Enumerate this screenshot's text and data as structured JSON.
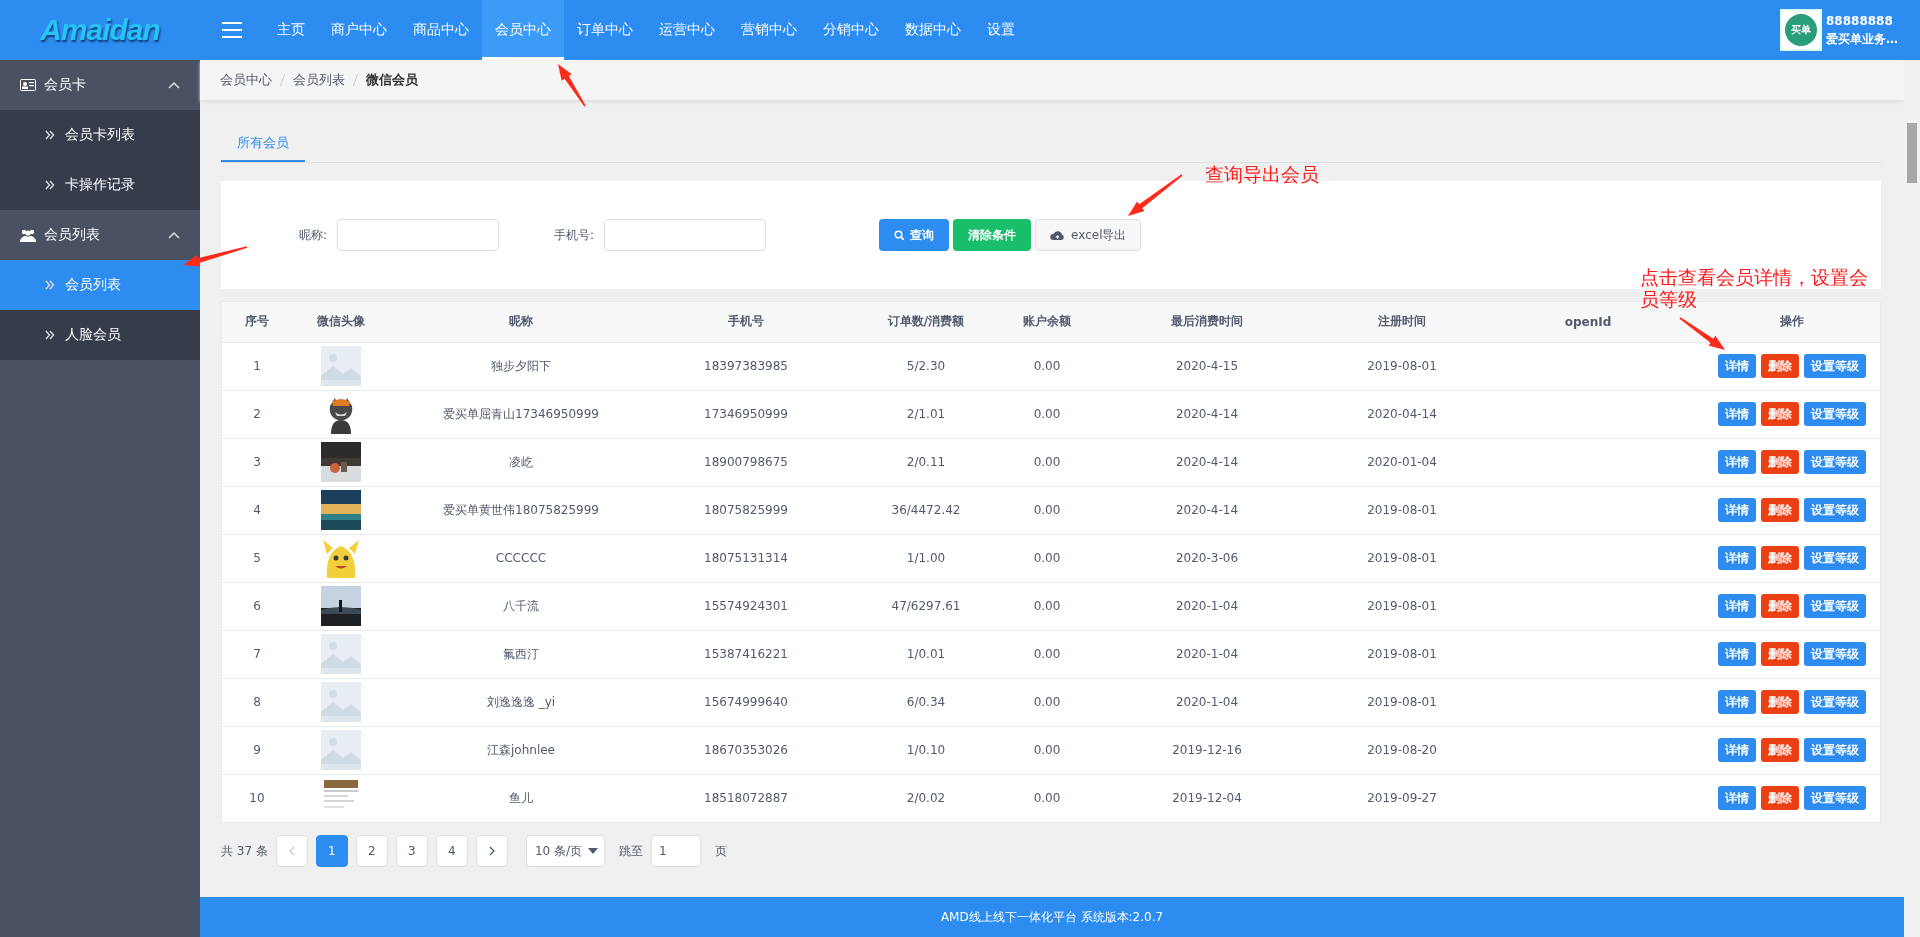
{
  "logo": "Amaidan",
  "nav": [
    {
      "label": "主页",
      "selected": false
    },
    {
      "label": "商户中心",
      "selected": false
    },
    {
      "label": "商品中心",
      "selected": false
    },
    {
      "label": "会员中心",
      "selected": true
    },
    {
      "label": "订单中心",
      "selected": false
    },
    {
      "label": "运营中心",
      "selected": false
    },
    {
      "label": "营销中心",
      "selected": false
    },
    {
      "label": "分销中心",
      "selected": false
    },
    {
      "label": "数据中心",
      "selected": false
    },
    {
      "label": "设置",
      "selected": false
    }
  ],
  "user": {
    "badge": "买单",
    "id": "88888888",
    "name": "爱买单业务…"
  },
  "sidebar": [
    {
      "label": "会员卡",
      "kind": "card",
      "expanded": true,
      "children": [
        {
          "label": "会员卡列表",
          "selected": false
        },
        {
          "label": "卡操作记录",
          "selected": false
        }
      ]
    },
    {
      "label": "会员列表",
      "kind": "users",
      "expanded": true,
      "children": [
        {
          "label": "会员列表",
          "selected": true
        },
        {
          "label": "人脸会员",
          "selected": false
        }
      ]
    }
  ],
  "breadcrumb": [
    "会员中心",
    "会员列表",
    "微信会员"
  ],
  "tabs": [
    {
      "label": "所有会员",
      "selected": true
    }
  ],
  "filters": [
    {
      "label": "昵称:"
    },
    {
      "label": "手机号:"
    }
  ],
  "buttons": [
    {
      "kind": "search",
      "label": "查询"
    },
    {
      "kind": "clear",
      "label": "清除条件"
    },
    {
      "kind": "export",
      "label": "excel导出"
    }
  ],
  "table": {
    "columns": [
      "序号",
      "微信头像",
      "昵称",
      "手机号",
      "订单数/消费额",
      "账户余额",
      "最后消费时间",
      "注册时间",
      "openId",
      "操作"
    ],
    "rows": [
      {
        "no": "1",
        "avatar": {
          "kind": "picture"
        },
        "nickname": "独步夕阳下",
        "phone": "18397383985",
        "orders": "5/2.30",
        "balance": "0.00",
        "last": "2020-4-15",
        "registered": "2019-08-01",
        "actions": [
          {
            "kind": "primary",
            "label": "详情"
          },
          {
            "kind": "danger",
            "label": "删除"
          },
          {
            "kind": "primary",
            "label": "设置等级"
          }
        ]
      },
      {
        "no": "2",
        "avatar": {
          "kind": "picture"
        },
        "nickname": "爱买单屈青山17346950999",
        "phone": "17346950999",
        "orders": "2/1.01",
        "balance": "0.00",
        "last": "2020-4-14",
        "registered": "2020-04-14",
        "actions": [
          {
            "kind": "primary",
            "label": "详情"
          },
          {
            "kind": "danger",
            "label": "删除"
          },
          {
            "kind": "primary",
            "label": "设置等级"
          }
        ]
      },
      {
        "no": "3",
        "avatar": {
          "kind": "picture"
        },
        "nickname": "凌屹",
        "phone": "18900798675",
        "orders": "2/0.11",
        "balance": "0.00",
        "last": "2020-4-14",
        "registered": "2020-01-04",
        "actions": [
          {
            "kind": "primary",
            "label": "详情"
          },
          {
            "kind": "danger",
            "label": "删除"
          },
          {
            "kind": "primary",
            "label": "设置等级"
          }
        ]
      },
      {
        "no": "4",
        "avatar": {
          "kind": "picture"
        },
        "nickname": "爱买单黄世伟18075825999",
        "phone": "18075825999",
        "orders": "36/4472.42",
        "balance": "0.00",
        "last": "2020-4-14",
        "registered": "2019-08-01",
        "actions": [
          {
            "kind": "primary",
            "label": "详情"
          },
          {
            "kind": "danger",
            "label": "删除"
          },
          {
            "kind": "primary",
            "label": "设置等级"
          }
        ]
      },
      {
        "no": "5",
        "avatar": {
          "kind": "picture"
        },
        "nickname": "CCCCCC",
        "phone": "18075131314",
        "orders": "1/1.00",
        "balance": "0.00",
        "last": "2020-3-06",
        "registered": "2019-08-01",
        "actions": [
          {
            "kind": "primary",
            "label": "详情"
          },
          {
            "kind": "danger",
            "label": "删除"
          },
          {
            "kind": "primary",
            "label": "设置等级"
          }
        ]
      },
      {
        "no": "6",
        "avatar": {
          "kind": "picture"
        },
        "nickname": "八千流",
        "phone": "15574924301",
        "orders": "47/6297.61",
        "balance": "0.00",
        "last": "2020-1-04",
        "registered": "2019-08-01",
        "actions": [
          {
            "kind": "primary",
            "label": "详情"
          },
          {
            "kind": "danger",
            "label": "删除"
          },
          {
            "kind": "primary",
            "label": "设置等级"
          }
        ]
      },
      {
        "no": "7",
        "avatar": {
          "kind": "picture"
        },
        "nickname": "氟西汀",
        "phone": "15387416221",
        "orders": "1/0.01",
        "balance": "0.00",
        "last": "2020-1-04",
        "registered": "2019-08-01",
        "actions": [
          {
            "kind": "primary",
            "label": "详情"
          },
          {
            "kind": "danger",
            "label": "删除"
          },
          {
            "kind": "primary",
            "label": "设置等级"
          }
        ]
      },
      {
        "no": "8",
        "avatar": {
          "kind": "picture"
        },
        "nickname": "刘逸逸逸 _yi",
        "phone": "15674999640",
        "orders": "6/0.34",
        "balance": "0.00",
        "last": "2020-1-04",
        "registered": "2019-08-01",
        "actions": [
          {
            "kind": "primary",
            "label": "详情"
          },
          {
            "kind": "danger",
            "label": "删除"
          },
          {
            "kind": "primary",
            "label": "设置等级"
          }
        ]
      },
      {
        "no": "9",
        "avatar": {
          "kind": "picture"
        },
        "nickname": "江森johnlee",
        "phone": "18670353026",
        "orders": "1/0.10",
        "balance": "0.00",
        "last": "2019-12-16",
        "registered": "2019-08-20",
        "actions": [
          {
            "kind": "primary",
            "label": "详情"
          },
          {
            "kind": "danger",
            "label": "删除"
          },
          {
            "kind": "primary",
            "label": "设置等级"
          }
        ]
      },
      {
        "no": "10",
        "avatar": {
          "kind": "picture"
        },
        "nickname": "鱼儿",
        "phone": "18518072887",
        "orders": "2/0.02",
        "balance": "0.00",
        "last": "2019-12-04",
        "registered": "2019-09-27",
        "actions": [
          {
            "kind": "primary",
            "label": "详情"
          },
          {
            "kind": "danger",
            "label": "删除"
          },
          {
            "kind": "primary",
            "label": "设置等级"
          }
        ]
      }
    ]
  },
  "pagination": {
    "total": "共 37 条",
    "pages": [
      {
        "label": "1",
        "selected": true
      },
      {
        "label": "2",
        "selected": false
      },
      {
        "label": "3",
        "selected": false
      },
      {
        "label": "4",
        "selected": false
      }
    ],
    "page_size": "10 条/页",
    "jump_label": "跳至",
    "jump_value": "1",
    "jump_suffix": "页"
  },
  "notes": [
    "查询导出会员",
    "点击查看会员详情，设置会员等级"
  ],
  "footer": "AMD线上线下一体化平台 系统版本:2.0.7"
}
